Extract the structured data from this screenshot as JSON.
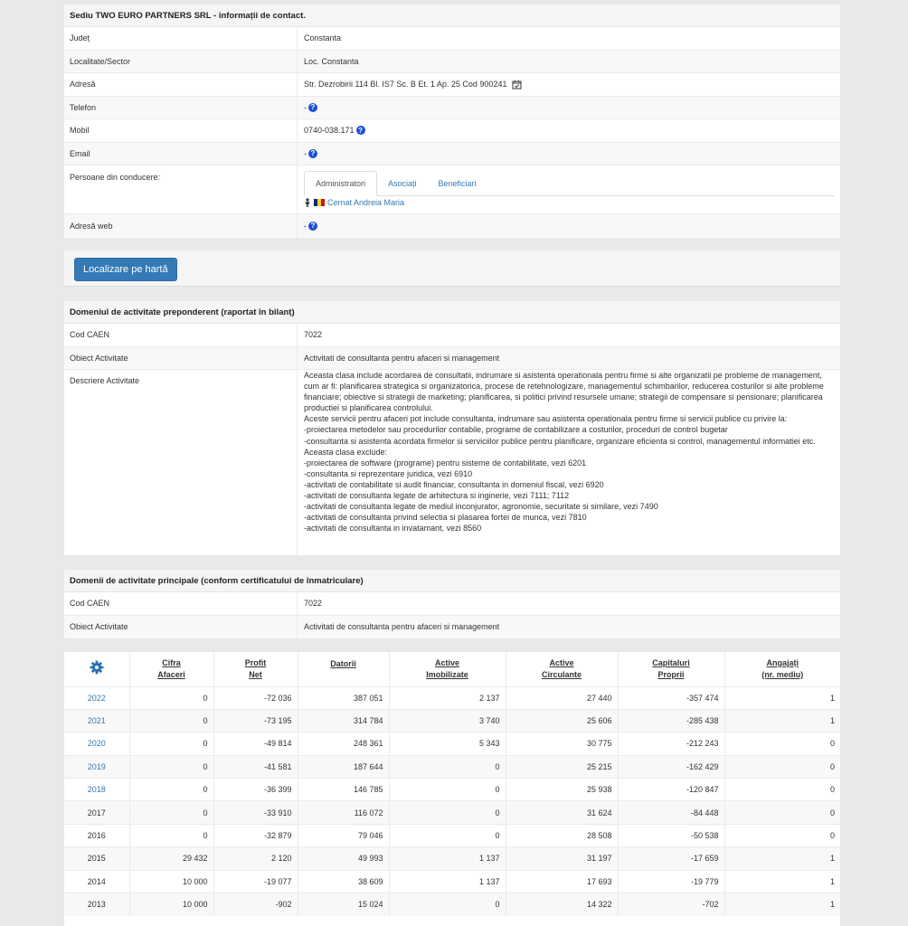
{
  "contact": {
    "title": "Sediu TWO EURO PARTNERS SRL - informații de contact.",
    "judet_label": "Județ",
    "judet_value": "Constanta",
    "localitate_label": "Localitate/Sector",
    "localitate_value": "Loc. Constanta",
    "adresa_label": "Adresă",
    "adresa_value": "Str. Dezrobirii 114 Bl. IS7 Sc. B Et. 1 Ap. 25 Cod 900241",
    "telefon_label": "Telefon",
    "telefon_value": "-",
    "mobil_label": "Mobil",
    "mobil_value": "0740-038.171",
    "email_label": "Email",
    "email_value": "-",
    "persoane_label": "Persoane din conducere:",
    "tabs": [
      "Administratori",
      "Asociați",
      "Beneficiari"
    ],
    "admin_name": "Cernat Andreia Maria",
    "web_label": "Adresă web",
    "web_value": "-",
    "help_icon": "question-circle-icon"
  },
  "map_button": "Localizare pe hartă",
  "preponderent": {
    "title": "Domeniul de activitate preponderent (raportat în bilanț)",
    "caen_label": "Cod CAEN",
    "caen_value": "7022",
    "obiect_label": "Obiect Activitate",
    "obiect_value": "Activitati de consultanta pentru afaceri si management",
    "descriere_label": "Descriere Activitate",
    "descriere_lines": [
      "Aceasta clasa include acordarea de consultatii, indrumare si asistenta operationala pentru firme si alte organizatii pe probleme de management, cum ar fi: planificarea strategica si organizatorica, procese de retehnologizare, managementul schimbarilor, reducerea costurilor si alte probleme financiare; obiective si strategii de marketing; planificarea, si politici privind resursele umane; strategii de compensare si pensionare; planificarea productiei si planificarea controlului.",
      "Aceste servicii pentru afaceri pot include consultanta, indrumare sau asistenta operationala pentru firme si servicii publice cu privire la:",
      "-proiectarea metodelor sau procedurilor contabile, programe de contabilizare a costurilor, proceduri de control bugetar",
      "-consultanta si asistenta acordata firmelor si serviciilor publice pentru planificare, organizare eficienta si control, managementul informatiei etc.",
      "Aceasta clasa exclude:",
      "-proiectarea de software (programe) pentru sisteme de contabilitate, vezi 6201",
      "-consultanta si reprezentare juridica, vezi 6910",
      "-activitati de contabilitate si audit financiar, consultanta in domeniul fiscal, vezi 6920",
      "-activitati de consultanta legate de arhitectura si inginerie, vezi 7111; 7112",
      "-activitati de consultanta legate de mediul inconjurator, agronomie, securitate si similare, vezi 7490",
      "-activitati de consultanta privind selectia si plasarea fortei de munca, vezi 7810",
      "-activitati de consultanta in invatamant, vezi 8560"
    ]
  },
  "principale": {
    "title": "Domenii de activitate principale (conform certificatului de înmatriculare)",
    "caen_label": "Cod CAEN",
    "caen_value": "7022",
    "obiect_label": "Obiect Activitate",
    "obiect_value": "Activitati de consultanta pentru afaceri si management"
  },
  "financial": {
    "settings_icon": "gear-icon",
    "headers": [
      [
        "Cifra",
        "Afaceri"
      ],
      [
        "Profit",
        "Net"
      ],
      [
        "Datorii",
        ""
      ],
      [
        "Active",
        "Imobilizate"
      ],
      [
        "Active",
        "Circulante"
      ],
      [
        "Capitaluri",
        "Proprii"
      ],
      [
        "Angajați",
        "(nr. mediu)"
      ]
    ],
    "rows": [
      {
        "year": "2022",
        "link": true,
        "values": [
          "0",
          "-72 036",
          "387 051",
          "2 137",
          "27 440",
          "-357 474",
          "1"
        ]
      },
      {
        "year": "2021",
        "link": true,
        "values": [
          "0",
          "-73 195",
          "314 784",
          "3 740",
          "25 606",
          "-285 438",
          "1"
        ]
      },
      {
        "year": "2020",
        "link": true,
        "values": [
          "0",
          "-49 814",
          "248 361",
          "5 343",
          "30 775",
          "-212 243",
          "0"
        ]
      },
      {
        "year": "2019",
        "link": true,
        "values": [
          "0",
          "-41 581",
          "187 644",
          "0",
          "25 215",
          "-162 429",
          "0"
        ]
      },
      {
        "year": "2018",
        "link": true,
        "values": [
          "0",
          "-36 399",
          "146 785",
          "0",
          "25 938",
          "-120 847",
          "0"
        ]
      },
      {
        "year": "2017",
        "link": false,
        "values": [
          "0",
          "-33 910",
          "116 072",
          "0",
          "31 624",
          "-84 448",
          "0"
        ]
      },
      {
        "year": "2016",
        "link": false,
        "values": [
          "0",
          "-32 879",
          "79 046",
          "0",
          "28 508",
          "-50 538",
          "0"
        ]
      },
      {
        "year": "2015",
        "link": false,
        "values": [
          "29 432",
          "2 120",
          "49 993",
          "1 137",
          "31 197",
          "-17 659",
          "1"
        ]
      },
      {
        "year": "2014",
        "link": false,
        "values": [
          "10 000",
          "-19 077",
          "38 609",
          "1 137",
          "17 693",
          "-19 779",
          "1"
        ]
      },
      {
        "year": "2013",
        "link": false,
        "values": [
          "10 000",
          "-902",
          "15 024",
          "0",
          "14 322",
          "-702",
          "1"
        ]
      }
    ]
  }
}
